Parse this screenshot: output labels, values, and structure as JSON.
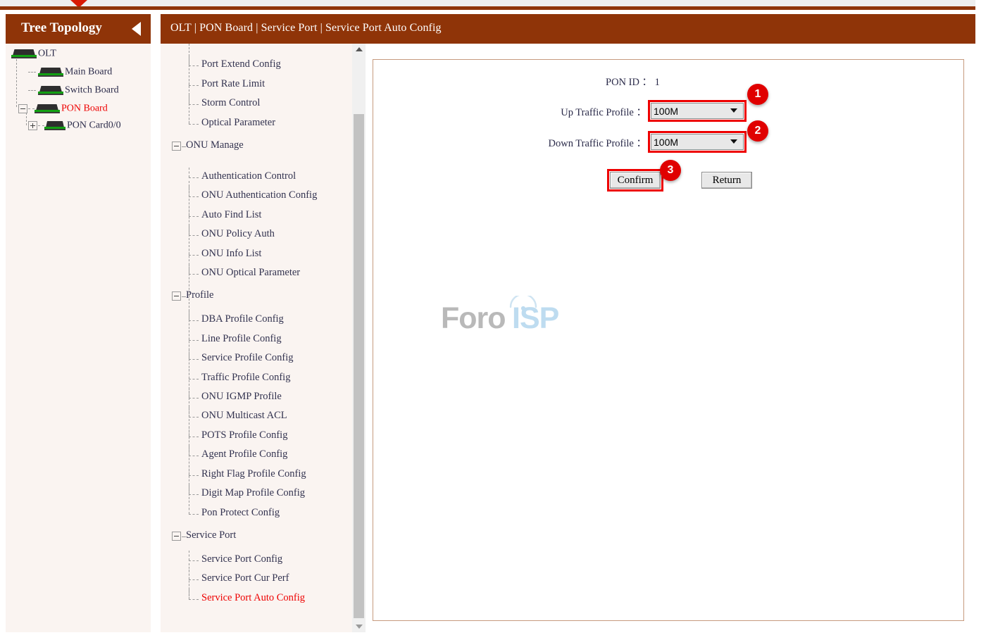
{
  "header": {
    "tree_title": "Tree Topology",
    "breadcrumb": "OLT | PON Board | Service Port | Service Port Auto Config",
    "collapse_icon": "triangle-left-icon",
    "top_marker_icon": "triangle-down-marker-icon",
    "brand_color": "#8f3408",
    "accent_red": "#ee0000"
  },
  "tree": {
    "nodes": [
      {
        "label": "OLT",
        "icon": "device-olt-icon",
        "toggle": "",
        "highlight": false
      },
      {
        "label": "Main Board",
        "icon": "device-board-icon",
        "toggle": "",
        "highlight": false
      },
      {
        "label": "Switch Board",
        "icon": "device-board-icon",
        "toggle": "",
        "highlight": false
      },
      {
        "label": "PON Board",
        "icon": "device-board-icon",
        "toggle": "minus",
        "highlight": true
      },
      {
        "label": "PON Card0/0",
        "icon": "device-card-icon",
        "toggle": "plus",
        "highlight": false
      }
    ]
  },
  "menu": {
    "items": [
      {
        "label": "Port Extend Config",
        "type": "leaf",
        "active": false
      },
      {
        "label": "Port Rate Limit",
        "type": "leaf",
        "active": false
      },
      {
        "label": "Storm Control",
        "type": "leaf",
        "active": false
      },
      {
        "label": "Optical Parameter",
        "type": "leaf",
        "active": false
      },
      {
        "label": "ONU Manage",
        "type": "group",
        "active": false
      },
      {
        "label": "Authentication Control",
        "type": "leaf",
        "active": false
      },
      {
        "label": "ONU Authentication Config",
        "type": "leaf",
        "active": false
      },
      {
        "label": "Auto Find List",
        "type": "leaf",
        "active": false
      },
      {
        "label": "ONU Policy Auth",
        "type": "leaf",
        "active": false
      },
      {
        "label": "ONU Info List",
        "type": "leaf",
        "active": false
      },
      {
        "label": "ONU Optical Parameter",
        "type": "leaf",
        "active": false
      },
      {
        "label": "Profile",
        "type": "group",
        "active": false
      },
      {
        "label": "DBA Profile Config",
        "type": "leaf",
        "active": false
      },
      {
        "label": "Line Profile Config",
        "type": "leaf",
        "active": false
      },
      {
        "label": "Service Profile Config",
        "type": "leaf",
        "active": false
      },
      {
        "label": "Traffic Profile Config",
        "type": "leaf",
        "active": false
      },
      {
        "label": "ONU IGMP Profile",
        "type": "leaf",
        "active": false
      },
      {
        "label": "ONU Multicast ACL",
        "type": "leaf",
        "active": false
      },
      {
        "label": "POTS Profile Config",
        "type": "leaf",
        "active": false
      },
      {
        "label": "Agent Profile Config",
        "type": "leaf",
        "active": false
      },
      {
        "label": "Right Flag Profile Config",
        "type": "leaf",
        "active": false
      },
      {
        "label": "Digit Map Profile Config",
        "type": "leaf",
        "active": false
      },
      {
        "label": "Pon Protect Config",
        "type": "leaf",
        "active": false
      },
      {
        "label": "Service Port",
        "type": "group",
        "active": false
      },
      {
        "label": "Service Port Config",
        "type": "leaf",
        "active": false
      },
      {
        "label": "Service Port Cur Perf",
        "type": "leaf",
        "active": false
      },
      {
        "label": "Service Port Auto Config",
        "type": "leaf",
        "active": true
      }
    ]
  },
  "scrollbar": {
    "up_icon": "scroll-up-arrow-icon",
    "down_icon": "scroll-down-arrow-icon"
  },
  "form": {
    "pon_id": "PON ID ： 1",
    "up_label": "Up Traffic Profile ：",
    "down_label": "Down Traffic Profile ：",
    "up_value": "100M",
    "down_value": "100M",
    "options": [
      "100M"
    ],
    "confirm_label": "Confirm",
    "return_label": "Return"
  },
  "annotations": {
    "badge1": "1",
    "badge2": "2",
    "badge3": "3"
  },
  "watermark": {
    "part1": "Foro",
    "part2": "ISP",
    "arc_icon": "wifi-arc-icon"
  }
}
